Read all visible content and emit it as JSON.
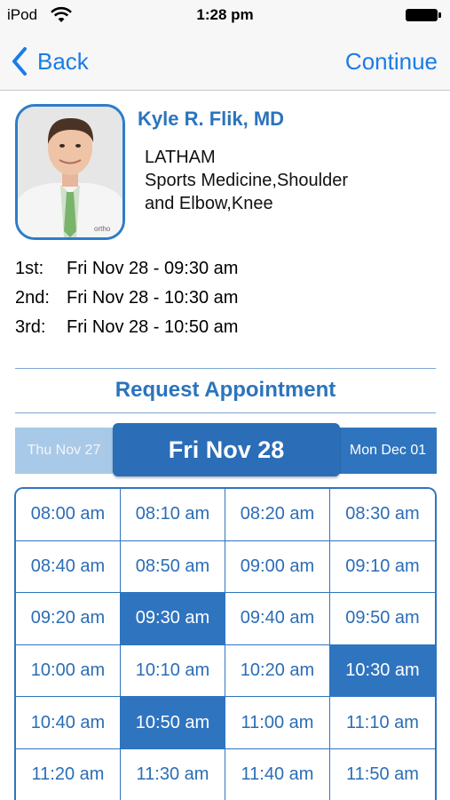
{
  "status_bar": {
    "carrier": "iPod",
    "time": "1:28 pm"
  },
  "nav": {
    "back_label": "Back",
    "continue_label": "Continue"
  },
  "doctor": {
    "name": "Kyle R. Flik, MD",
    "location": "LATHAM",
    "specialty_line1": "Sports Medicine,Shoulder",
    "specialty_line2": "and Elbow,Knee",
    "photo_badge_text": "ortho"
  },
  "choices": [
    {
      "rank": "1st:",
      "value": "Fri Nov 28 - 09:30 am"
    },
    {
      "rank": "2nd:",
      "value": "Fri Nov 28 - 10:30 am"
    },
    {
      "rank": "3rd:",
      "value": "Fri Nov 28 - 10:50 am"
    }
  ],
  "request_title": "Request Appointment",
  "day_selector": {
    "prev": "Thu Nov 27",
    "current": "Fri Nov 28",
    "next": "Mon Dec 01"
  },
  "times": [
    {
      "label": "08:00 am",
      "selected": false
    },
    {
      "label": "08:10 am",
      "selected": false
    },
    {
      "label": "08:20 am",
      "selected": false
    },
    {
      "label": "08:30 am",
      "selected": false
    },
    {
      "label": "08:40 am",
      "selected": false
    },
    {
      "label": "08:50 am",
      "selected": false
    },
    {
      "label": "09:00 am",
      "selected": false
    },
    {
      "label": "09:10 am",
      "selected": false
    },
    {
      "label": "09:20 am",
      "selected": false
    },
    {
      "label": "09:30 am",
      "selected": true
    },
    {
      "label": "09:40 am",
      "selected": false
    },
    {
      "label": "09:50 am",
      "selected": false
    },
    {
      "label": "10:00 am",
      "selected": false
    },
    {
      "label": "10:10 am",
      "selected": false
    },
    {
      "label": "10:20 am",
      "selected": false
    },
    {
      "label": "10:30 am",
      "selected": true
    },
    {
      "label": "10:40 am",
      "selected": false
    },
    {
      "label": "10:50 am",
      "selected": true
    },
    {
      "label": "11:00 am",
      "selected": false
    },
    {
      "label": "11:10 am",
      "selected": false
    },
    {
      "label": "11:20 am",
      "selected": false
    },
    {
      "label": "11:30 am",
      "selected": false
    },
    {
      "label": "11:40 am",
      "selected": false
    },
    {
      "label": "11:50 am",
      "selected": false
    }
  ],
  "colors": {
    "accent": "#2f74bf",
    "link": "#1a7ce6"
  }
}
